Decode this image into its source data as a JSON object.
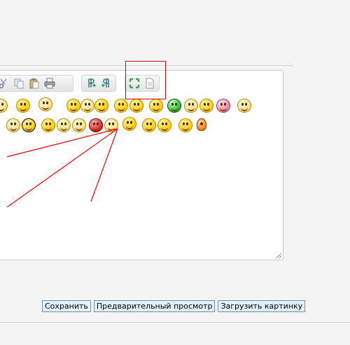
{
  "toolbar": {
    "group1": [
      "cut-icon",
      "copy-icon",
      "paste-icon",
      "print-icon"
    ],
    "group2": [
      "ltr-icon",
      "rtl-icon"
    ],
    "group3": [
      "maximize-icon",
      "source-icon"
    ]
  },
  "actions": {
    "save_label": "Сохранить",
    "preview_label": "Предварительный просмотр",
    "upload_label": "Загрузить картинку"
  },
  "annotation": {
    "highlight_color": "#e00000",
    "arrow_color": "#ff0000"
  },
  "colors": {
    "button_bg": "#e1f0fa",
    "button_border": "#6b93b7",
    "page_bg": "#f4f4f4"
  }
}
